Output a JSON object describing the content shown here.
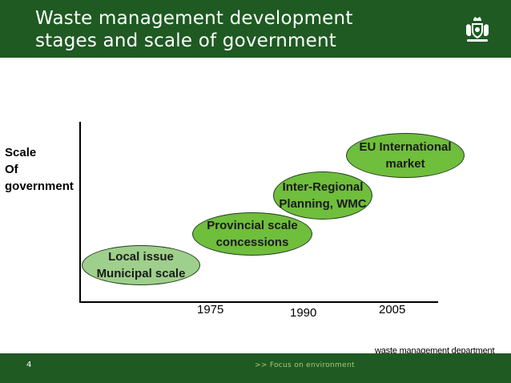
{
  "header": {
    "title": "Waste management development\nstages and scale of government",
    "logo_icon": "royal-crest-icon"
  },
  "diagram": {
    "y_axis_label": "Scale\nOf\ngovernment",
    "x_ticks": [
      "1975",
      "1990",
      "2005"
    ],
    "stages": [
      {
        "label": "Local issue\nMunicipal scale",
        "color": "#9fcf8c"
      },
      {
        "label": "Provincial scale\nconcessions",
        "color": "#6fbe3c"
      },
      {
        "label": "Inter-Regional\nPlanning, WMC",
        "color": "#6fbe3c"
      },
      {
        "label": "EU International\nmarket",
        "color": "#6fbe3c"
      }
    ]
  },
  "department": "waste management department",
  "footer": {
    "page_number": "4",
    "tagline": ">>  Focus on environment"
  },
  "colors": {
    "brand_green": "#1e5a22",
    "tagline_green": "#a9c77a"
  }
}
